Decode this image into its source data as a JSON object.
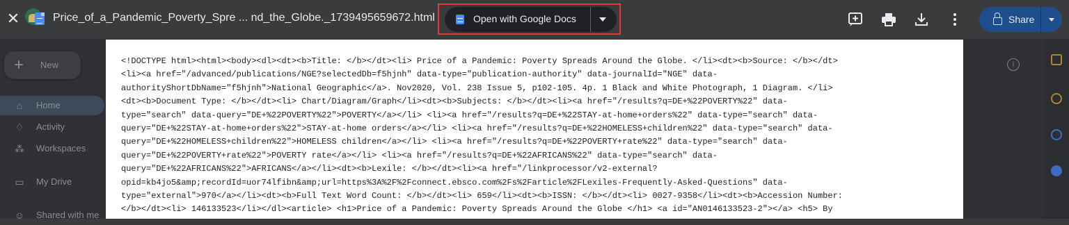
{
  "topbar": {
    "filename": "Price_of_a_Pandemic_Poverty_Spre ... nd_the_Globe._1739495659672.html",
    "open_with_label": "Open with Google Docs",
    "share_label": "Share",
    "icons": [
      "close-icon",
      "add-comment-icon",
      "print-icon",
      "download-icon",
      "more-vert-icon"
    ]
  },
  "background": {
    "new_label": "New",
    "nav": [
      {
        "label": "Home",
        "icon": "home-icon"
      },
      {
        "label": "Activity",
        "icon": "bell-icon"
      },
      {
        "label": "Workspaces",
        "icon": "workspaces-icon"
      },
      {
        "label": "My Drive",
        "icon": "drive-icon"
      },
      {
        "label": "Shared with me",
        "icon": "people-icon"
      }
    ]
  },
  "document": {
    "lines": [
      "<!DOCTYPE html><html><body><dl><dt><b>Title: </b></dt><li> Price of a Pandemic: Poverty Spreads Around the Globe. </li><dt><b>Source: </b></dt>",
      "<li><a href=\"/advanced/publications/NGE?selectedDb=f5hjnh\" data-type=\"publication-authority\" data-journalId=\"NGE\" data-",
      "authorityShortDbName=\"f5hjnh\">National Geographic</a>. Nov2020, Vol. 238 Issue 5, p102-105. 4p. 1 Black and White Photograph, 1 Diagram. </li>",
      "<dt><b>Document Type: </b></dt><li> Chart/Diagram/Graph</li><dt><b>Subjects: </b></dt><li><a href=\"/results?q=DE+%22POVERTY%22\" data-",
      "type=\"search\" data-query=\"DE+%22POVERTY%22\">POVERTY</a></li> <li><a href=\"/results?q=DE+%22STAY-at-home+orders%22\" data-type=\"search\" data-",
      "query=\"DE+%22STAY-at-home+orders%22\">STAY-at-home orders</a></li> <li><a href=\"/results?q=DE+%22HOMELESS+children%22\" data-type=\"search\" data-",
      "query=\"DE+%22HOMELESS+children%22\">HOMELESS children</a></li> <li><a href=\"/results?q=DE+%22POVERTY+rate%22\" data-type=\"search\" data-",
      "query=\"DE+%22POVERTY+rate%22\">POVERTY rate</a></li> <li><a href=\"/results?q=DE+%22AFRICANS%22\" data-type=\"search\" data-",
      "query=\"DE+%22AFRICANS%22\">AFRICANS</a></li><dt><b>Lexile: </b></dt><li><a href=\"/linkprocessor/v2-external?",
      "opid=kb4jo5&amp;recordId=uor74lfibn&amp;url=https%3A%2F%2Fconnect.ebsco.com%2Fs%2Farticle%2FLexiles-Frequently-Asked-Questions\" data-",
      "type=\"external\">970</a></li><dt><b>Full Text Word Count: </b></dt><li> 659</li><dt><b>ISSN: </b></dt><li> 0027-9358</li><dt><b>Accession Number:",
      "</b></dt><li> 146133523</li></dl><article> <h1>Price of a Pandemic: Poverty Spreads Around the Globe </h1> <a id=\"AN0146133523-2\"></a> <h5> By"
    ]
  }
}
